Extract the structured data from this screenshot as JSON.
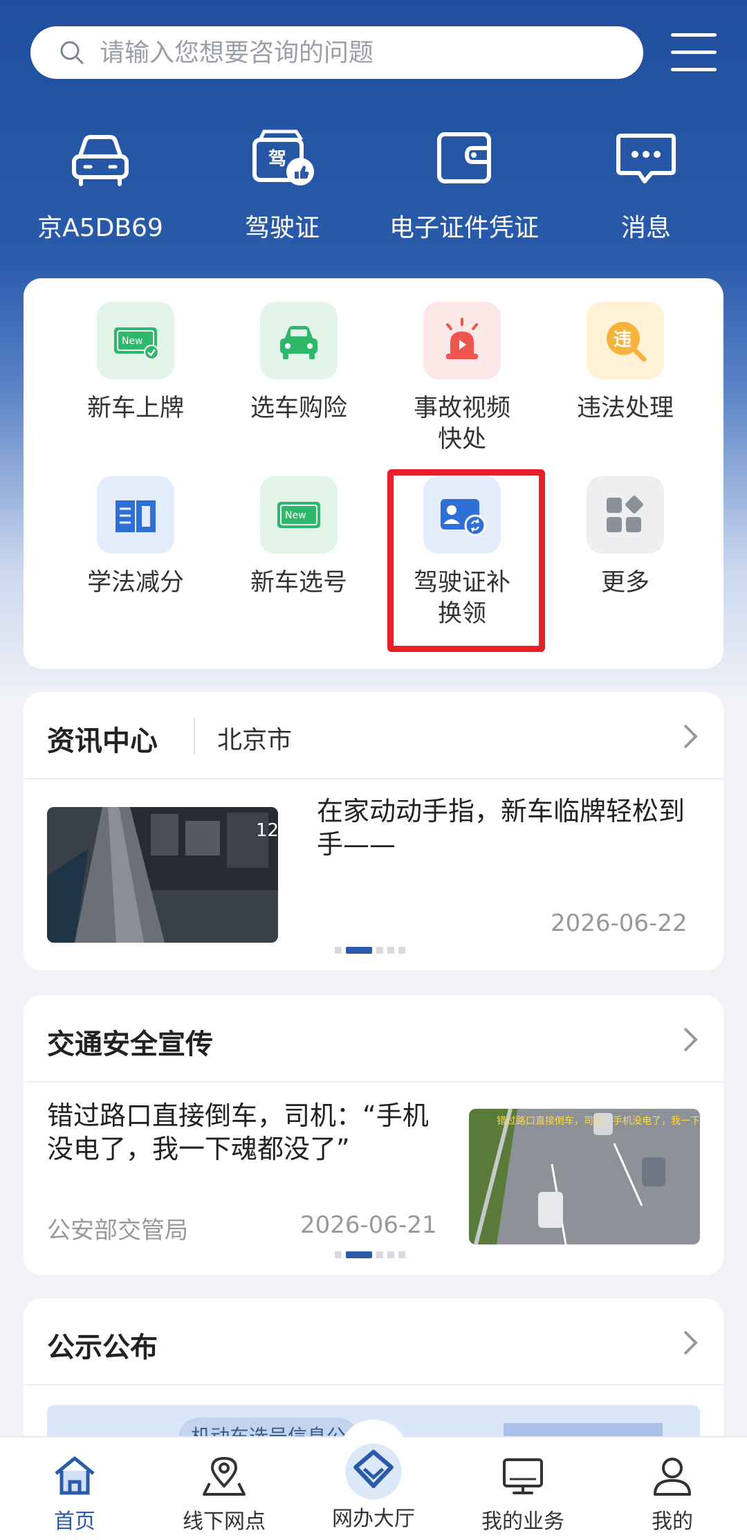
{
  "search": {
    "placeholder": "请输入您想要咨询的问题"
  },
  "quick": [
    {
      "label": "京A5DB69",
      "icon": "car-icon"
    },
    {
      "label": "驾驶证",
      "icon": "license-icon"
    },
    {
      "label": "电子证件凭证",
      "icon": "wallet-icon"
    },
    {
      "label": "消息",
      "icon": "message-icon"
    }
  ],
  "services": [
    {
      "label": "新车上牌",
      "icon": "new-plate-icon"
    },
    {
      "label": "选车购险",
      "icon": "car-insurance-icon"
    },
    {
      "label": "事故视频快处",
      "icon": "alarm-icon"
    },
    {
      "label": "违法处理",
      "icon": "violation-icon"
    },
    {
      "label": "学法减分",
      "icon": "book-icon"
    },
    {
      "label": "新车选号",
      "icon": "new-number-icon"
    },
    {
      "label": "驾驶证补换领",
      "icon": "license-renew-icon"
    },
    {
      "label": "更多",
      "icon": "more-icon"
    }
  ],
  "news_center": {
    "title": "资讯中心",
    "city": "北京市",
    "article": {
      "title": "在家动动手指，新车临牌轻松到手——",
      "date": "2026-06-22"
    }
  },
  "safety": {
    "title": "交通安全宣传",
    "article": {
      "title": "错过路口直接倒车，司机：“手机没电了，我一下魂都没了”",
      "source": "公安部交管局",
      "date": "2026-06-21",
      "thumb_caption": "错过路口直接倒车，司机：手机没电了，我一下魂都没了"
    }
  },
  "notice": {
    "title": "公示公布",
    "preview": "机动车选号信息公"
  },
  "nav": [
    {
      "label": "首页",
      "icon": "home-icon"
    },
    {
      "label": "线下网点",
      "icon": "location-icon"
    },
    {
      "label": "网办大厅",
      "icon": "hall-icon"
    },
    {
      "label": "我的业务",
      "icon": "monitor-icon"
    },
    {
      "label": "我的",
      "icon": "person-icon"
    }
  ],
  "colors": {
    "brand": "#2a5bab",
    "highlight": "#e8202a"
  }
}
